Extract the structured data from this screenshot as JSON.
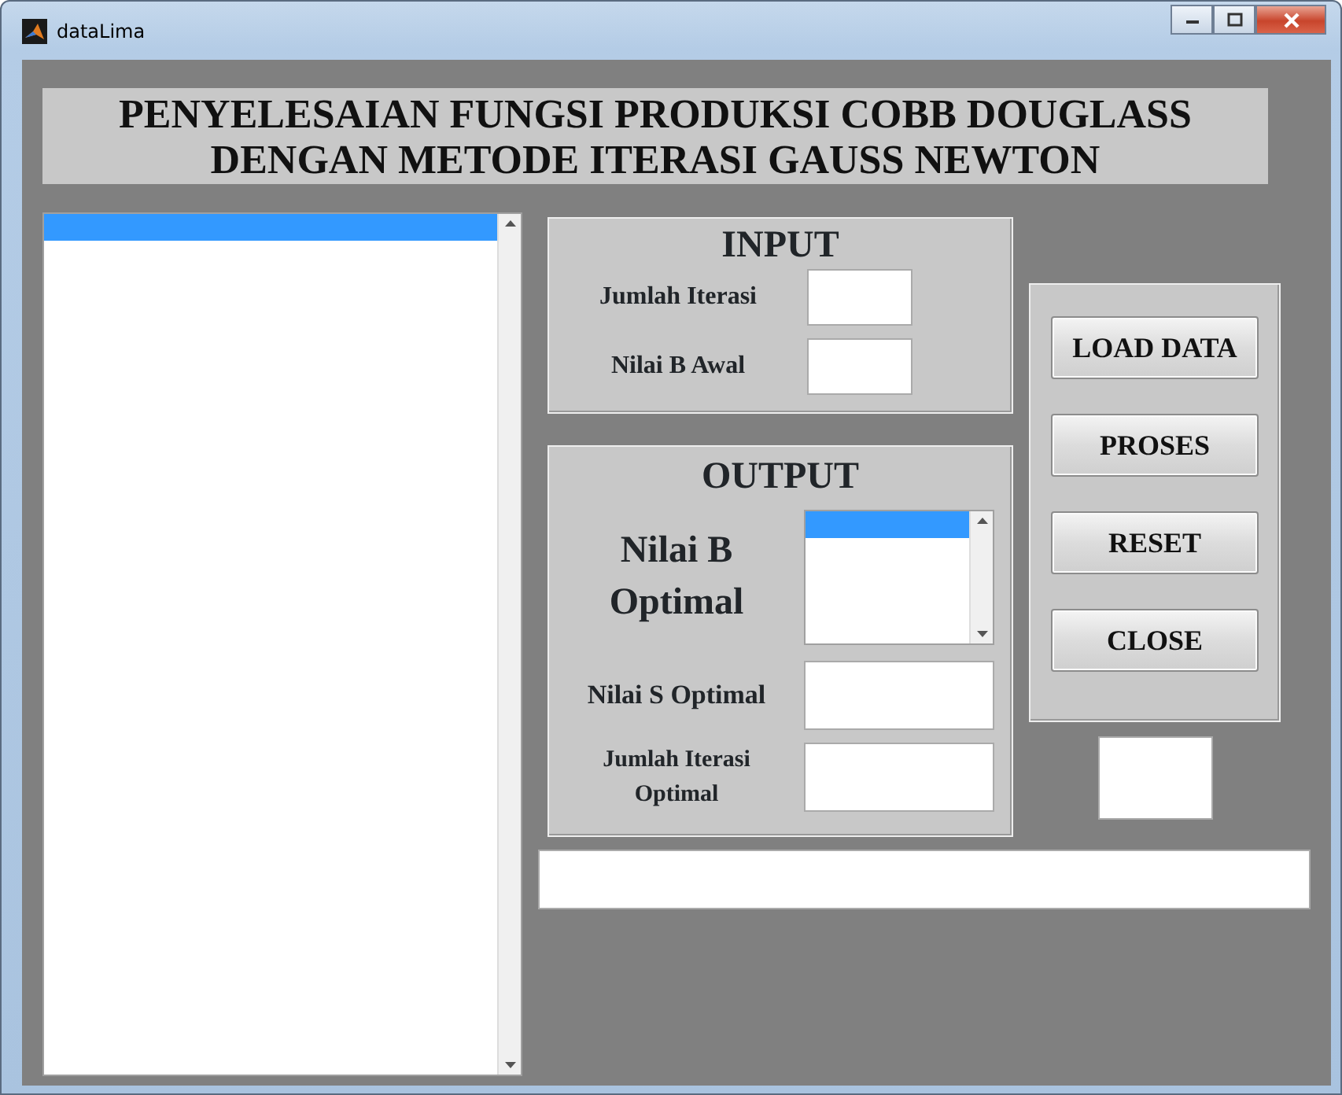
{
  "window": {
    "title": "dataLima"
  },
  "heading": {
    "lines": [
      "PENYELESAIAN FUNGSI PRODUKSI COBB DOUGLASS",
      "DENGAN METODE ITERASI GAUSS NEWTON"
    ]
  },
  "data_list": {
    "items": [
      {
        "selected": true
      }
    ]
  },
  "input_panel": {
    "title": "INPUT",
    "fields": [
      {
        "label": "Jumlah Iterasi"
      },
      {
        "label": "Nilai B Awal"
      }
    ]
  },
  "output_panel": {
    "title": "OUTPUT",
    "b_label": "Nilai B Optimal",
    "b_list": {
      "items": [
        {
          "selected": true
        }
      ]
    },
    "fields": [
      {
        "label": "Nilai S Optimal"
      },
      {
        "label": "Jumlah Iterasi Optimal"
      }
    ]
  },
  "buttons": [
    "LOAD DATA",
    "PROSES",
    "RESET",
    "CLOSE"
  ]
}
